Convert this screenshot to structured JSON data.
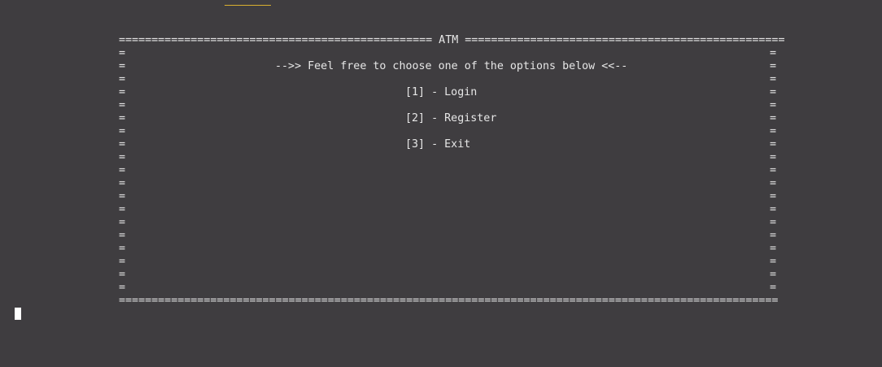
{
  "terminal": {
    "border_top": "================================================ ATM =================================================",
    "border_bottom": "=====================================================================================================",
    "side_char": "=",
    "prompt_line": "-->> Feel free to choose one of the options below <<--",
    "options": [
      "[1] - Login",
      "[2] - Register",
      "[3] - Exit"
    ]
  },
  "colors": {
    "background": "#3f3d40",
    "text": "#e6e6e6",
    "tab_accent": "#d9b02f",
    "cursor": "#ffffff"
  }
}
